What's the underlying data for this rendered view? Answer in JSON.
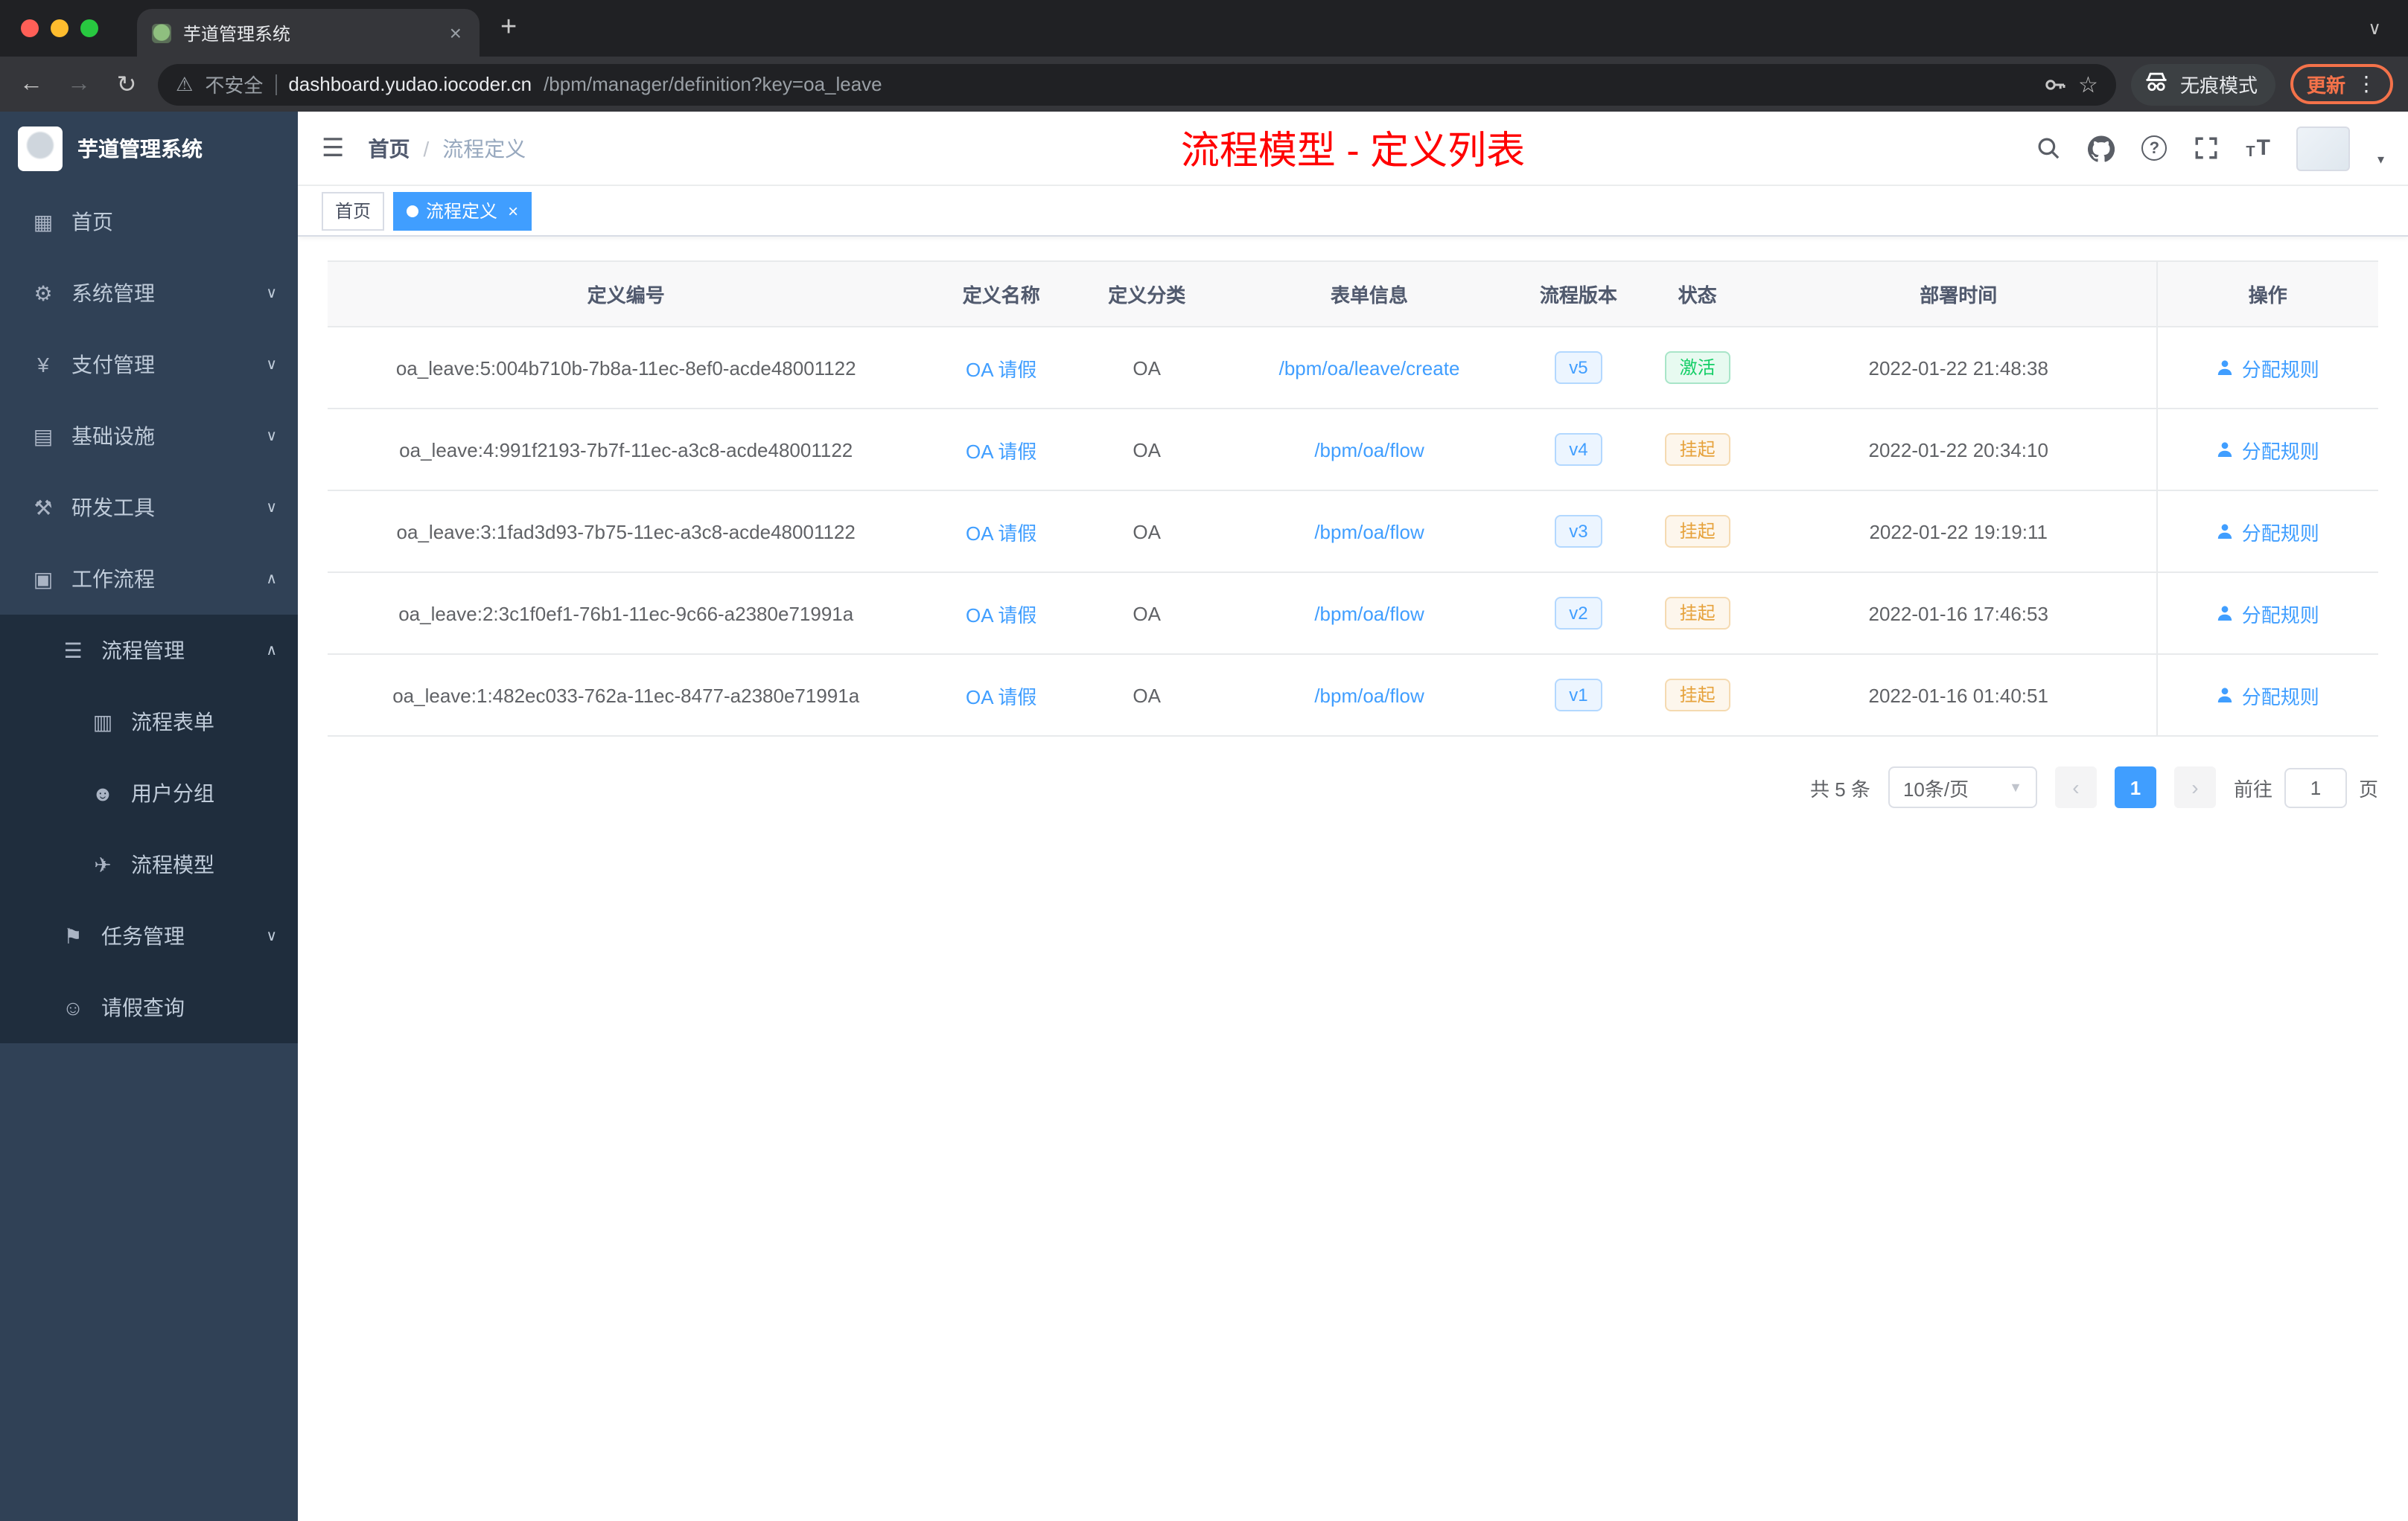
{
  "colors": {
    "accent": "#409eff",
    "success": "#13ce66",
    "warning": "#e6a23c",
    "banner_red": "#ff0000",
    "sidebar_bg": "#304156",
    "submenu_bg": "#1f2d3d"
  },
  "browser": {
    "tab": {
      "title": "芋道管理系统",
      "close": "×"
    },
    "new_tab": "+",
    "tab_chevron": "∨",
    "back": "←",
    "forward": "→",
    "reload": "↻",
    "security_icon": "⚠",
    "security": "不安全",
    "url_host": "dashboard.yudao.iocoder.cn",
    "url_path": "/bpm/manager/definition?key=oa_leave",
    "star": "☆",
    "incognito": "无痕模式",
    "update": "更新",
    "menu_dots": "⋮"
  },
  "sidebar": {
    "brand": "芋道管理系统",
    "menu": [
      {
        "icon": "▦",
        "label": "首页"
      },
      {
        "icon": "⚙",
        "label": "系统管理",
        "chevron": "∨"
      },
      {
        "icon": "¥",
        "label": "支付管理",
        "chevron": "∨"
      },
      {
        "icon": "▤",
        "label": "基础设施",
        "chevron": "∨"
      },
      {
        "icon": "⚒",
        "label": "研发工具",
        "chevron": "∨"
      },
      {
        "icon": "▣",
        "label": "工作流程",
        "chevron": "∧"
      },
      {
        "icon": "☰",
        "label": "流程管理",
        "chevron": "∧"
      },
      {
        "icon": "▥",
        "label": "流程表单"
      },
      {
        "icon": "☻",
        "label": "用户分组"
      },
      {
        "icon": "✈",
        "label": "流程模型"
      },
      {
        "icon": "⚑",
        "label": "任务管理",
        "chevron": "∨"
      },
      {
        "icon": "☺",
        "label": "请假查询"
      }
    ]
  },
  "header": {
    "hamburger": "☰",
    "breadcrumb_home": "首页",
    "breadcrumb_sep": "/",
    "breadcrumb_current": "流程定义",
    "banner": "流程模型 - 定义列表",
    "help": "?",
    "font_icon": "T",
    "avatar_caret": "▾"
  },
  "tags": {
    "home": "首页",
    "active": "流程定义",
    "close": "×"
  },
  "table": {
    "columns": [
      "定义编号",
      "定义名称",
      "定义分类",
      "表单信息",
      "流程版本",
      "状态",
      "部署时间",
      "操作"
    ],
    "rows": [
      {
        "id": "oa_leave:5:004b710b-7b8a-11ec-8ef0-acde48001122",
        "name": "OA 请假",
        "category": "OA",
        "form": "/bpm/oa/leave/create",
        "version": "v5",
        "status": "激活",
        "time": "2022-01-22 21:48:38",
        "action": "分配规则"
      },
      {
        "id": "oa_leave:4:991f2193-7b7f-11ec-a3c8-acde48001122",
        "name": "OA 请假",
        "category": "OA",
        "form": "/bpm/oa/flow",
        "version": "v4",
        "status": "挂起",
        "time": "2022-01-22 20:34:10",
        "action": "分配规则"
      },
      {
        "id": "oa_leave:3:1fad3d93-7b75-11ec-a3c8-acde48001122",
        "name": "OA 请假",
        "category": "OA",
        "form": "/bpm/oa/flow",
        "version": "v3",
        "status": "挂起",
        "time": "2022-01-22 19:19:11",
        "action": "分配规则"
      },
      {
        "id": "oa_leave:2:3c1f0ef1-76b1-11ec-9c66-a2380e71991a",
        "name": "OA 请假",
        "category": "OA",
        "form": "/bpm/oa/flow",
        "version": "v2",
        "status": "挂起",
        "time": "2022-01-16 17:46:53",
        "action": "分配规则"
      },
      {
        "id": "oa_leave:1:482ec033-762a-11ec-8477-a2380e71991a",
        "name": "OA 请假",
        "category": "OA",
        "form": "/bpm/oa/flow",
        "version": "v1",
        "status": "挂起",
        "time": "2022-01-16 01:40:51",
        "action": "分配规则"
      }
    ]
  },
  "pagination": {
    "total": "共 5 条",
    "page_size": "10条/页",
    "size_caret": "▼",
    "prev": "‹",
    "page": "1",
    "next": "›",
    "goto_label": "前往",
    "goto_value": "1",
    "goto_unit": "页"
  }
}
